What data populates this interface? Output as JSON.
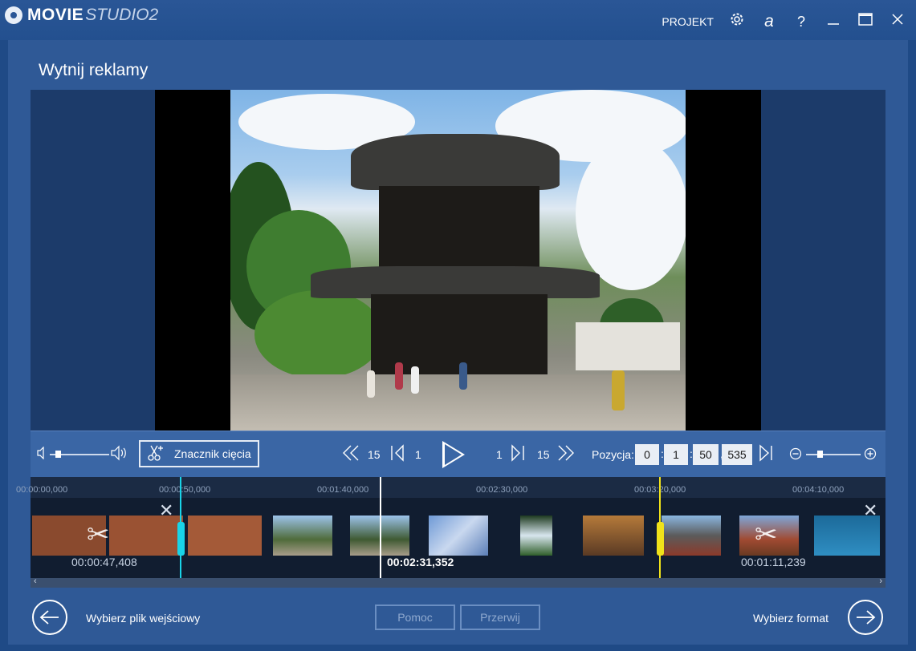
{
  "app": {
    "logo_main": "MOVIE",
    "logo_sub": "STUDIO2",
    "projekt_label": "PROJEKT",
    "help_glyph": "?",
    "letter_glyph": "a"
  },
  "page": {
    "title": "Wytnij reklamy"
  },
  "controls": {
    "cut_marker_label": "Znacznik cięcia",
    "rewind_num": "15",
    "step_back_num": "1",
    "step_fwd_num": "1",
    "forward_num": "15",
    "position_label": "Pozycja:",
    "position": {
      "hours": "0",
      "minutes": "1",
      "seconds": "50",
      "millis": "535"
    },
    "volume_level": 0.1,
    "zoom_level": 0.2
  },
  "timeline": {
    "ruler": [
      "00:00:00,000",
      "00:00:50,000",
      "00:01:40,000",
      "00:02:30,000",
      "00:03:20,000",
      "00:04:10,000"
    ],
    "left_duration": "00:00:47,408",
    "center_duration": "00:02:31,352",
    "right_duration": "00:01:11,239",
    "cut_start_color": "#19d4e8",
    "cut_end_color": "#f0e21a",
    "playhead_color": "#ffffff"
  },
  "bottom": {
    "back_label": "Wybierz plik wejściowy",
    "help_label": "Pomoc",
    "cancel_label": "Przerwij",
    "next_label": "Wybierz format"
  },
  "icons": {
    "settings": "gear-icon",
    "minimize": "minimize-icon",
    "maximize": "maximize-icon",
    "close": "close-icon"
  }
}
